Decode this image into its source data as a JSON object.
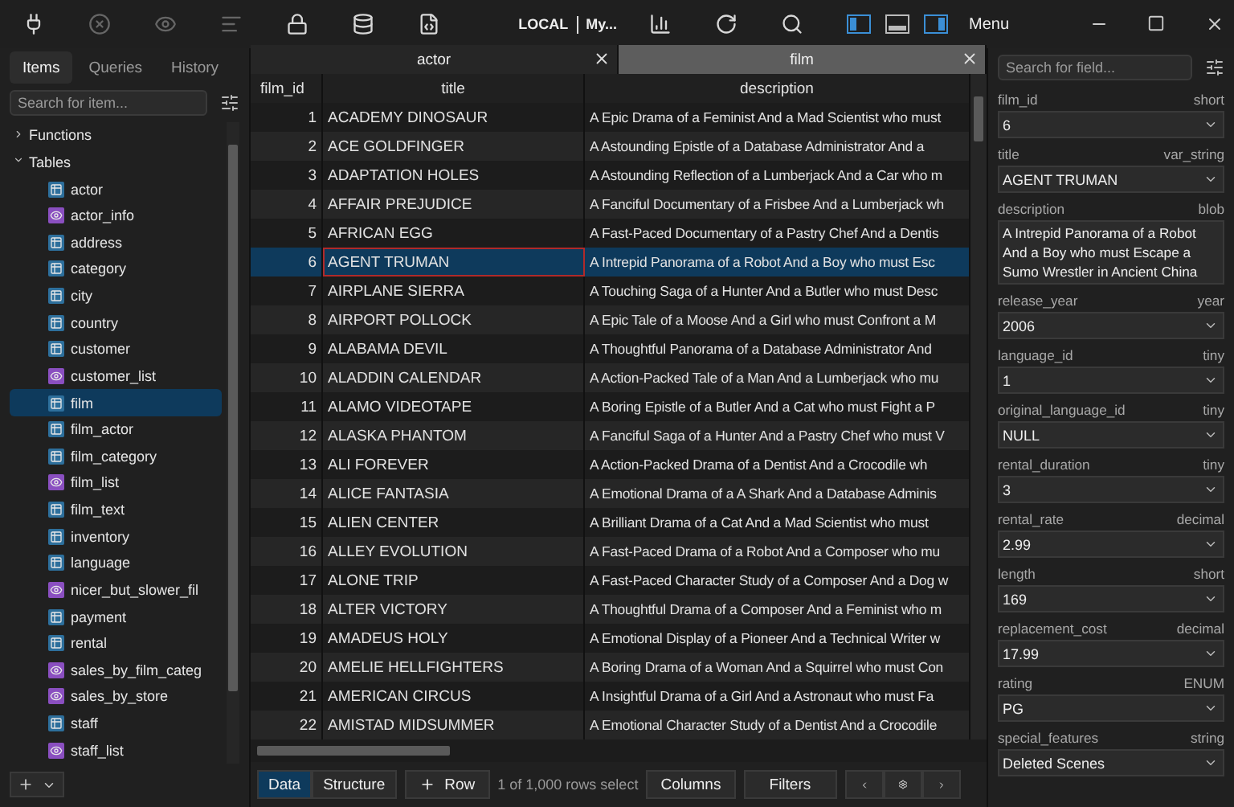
{
  "toolbar": {
    "connection": "LOCAL",
    "database": "My...",
    "panel_toggles": [
      {
        "kind": "left",
        "on": true
      },
      {
        "kind": "bottom",
        "on": false
      },
      {
        "kind": "right",
        "on": true
      }
    ],
    "menu": "Menu"
  },
  "sidebar": {
    "tabs": [
      {
        "label": "Items",
        "selected": true
      },
      {
        "label": "Queries",
        "selected": false
      },
      {
        "label": "History",
        "selected": false
      }
    ],
    "search": {
      "placeholder": "Search for item..."
    },
    "tree": [
      {
        "label": "Functions",
        "expanded": false
      },
      {
        "label": "Tables",
        "expanded": true,
        "children": [
          {
            "label": "actor",
            "kind": "table",
            "selected": false
          },
          {
            "label": "actor_info",
            "kind": "view",
            "selected": false
          },
          {
            "label": "address",
            "kind": "table",
            "selected": false
          },
          {
            "label": "category",
            "kind": "table",
            "selected": false
          },
          {
            "label": "city",
            "kind": "table",
            "selected": false
          },
          {
            "label": "country",
            "kind": "table",
            "selected": false
          },
          {
            "label": "customer",
            "kind": "table",
            "selected": false
          },
          {
            "label": "customer_list",
            "kind": "view",
            "selected": false
          },
          {
            "label": "film",
            "kind": "table",
            "selected": true
          },
          {
            "label": "film_actor",
            "kind": "table",
            "selected": false
          },
          {
            "label": "film_category",
            "kind": "table",
            "selected": false
          },
          {
            "label": "film_list",
            "kind": "view",
            "selected": false
          },
          {
            "label": "film_text",
            "kind": "table",
            "selected": false
          },
          {
            "label": "inventory",
            "kind": "table",
            "selected": false
          },
          {
            "label": "language",
            "kind": "table",
            "selected": false
          },
          {
            "label": "nicer_but_slower_fil",
            "kind": "view",
            "selected": false
          },
          {
            "label": "payment",
            "kind": "table",
            "selected": false
          },
          {
            "label": "rental",
            "kind": "table",
            "selected": false
          },
          {
            "label": "sales_by_film_categ",
            "kind": "view",
            "selected": false
          },
          {
            "label": "sales_by_store",
            "kind": "view",
            "selected": false
          },
          {
            "label": "staff",
            "kind": "table",
            "selected": false
          },
          {
            "label": "staff_list",
            "kind": "view",
            "selected": false
          }
        ]
      }
    ]
  },
  "tabs": [
    {
      "label": "actor",
      "selected": false
    },
    {
      "label": "film",
      "selected": true
    }
  ],
  "table": {
    "columns": [
      "film_id",
      "title",
      "description"
    ],
    "rows": [
      {
        "cells": [
          "1",
          "ACADEMY DINOSAUR",
          "A Epic Drama of a Feminist And a Mad Scientist who must"
        ],
        "selected": false
      },
      {
        "cells": [
          "2",
          "ACE GOLDFINGER",
          "A Astounding Epistle of a Database Administrator And a"
        ],
        "selected": false
      },
      {
        "cells": [
          "3",
          "ADAPTATION HOLES",
          "A Astounding Reflection of a Lumberjack And a Car who m"
        ],
        "selected": false
      },
      {
        "cells": [
          "4",
          "AFFAIR PREJUDICE",
          "A Fanciful Documentary of a Frisbee And a Lumberjack wh"
        ],
        "selected": false
      },
      {
        "cells": [
          "5",
          "AFRICAN EGG",
          "A Fast-Paced Documentary of a Pastry Chef And a Dentis"
        ],
        "selected": false
      },
      {
        "cells": [
          "6",
          "AGENT TRUMAN",
          "A Intrepid Panorama of a Robot And a Boy who must Esc"
        ],
        "selected": true
      },
      {
        "cells": [
          "7",
          "AIRPLANE SIERRA",
          "A Touching Saga of a Hunter And a Butler who must Desc"
        ],
        "selected": false
      },
      {
        "cells": [
          "8",
          "AIRPORT POLLOCK",
          "A Epic Tale of a Moose And a Girl who must Confront a M"
        ],
        "selected": false
      },
      {
        "cells": [
          "9",
          "ALABAMA DEVIL",
          "A Thoughtful Panorama of a Database Administrator And"
        ],
        "selected": false
      },
      {
        "cells": [
          "10",
          "ALADDIN CALENDAR",
          "A Action-Packed Tale of a Man And a Lumberjack who mu"
        ],
        "selected": false
      },
      {
        "cells": [
          "11",
          "ALAMO VIDEOTAPE",
          "A Boring Epistle of a Butler And a Cat who must Fight a P"
        ],
        "selected": false
      },
      {
        "cells": [
          "12",
          "ALASKA PHANTOM",
          "A Fanciful Saga of a Hunter And a Pastry Chef who must V"
        ],
        "selected": false
      },
      {
        "cells": [
          "13",
          "ALI FOREVER",
          "A Action-Packed Drama of a Dentist And a Crocodile wh"
        ],
        "selected": false
      },
      {
        "cells": [
          "14",
          "ALICE FANTASIA",
          "A Emotional Drama of a A Shark And a Database Adminis"
        ],
        "selected": false
      },
      {
        "cells": [
          "15",
          "ALIEN CENTER",
          "A Brilliant Drama of a Cat And a Mad Scientist who must"
        ],
        "selected": false
      },
      {
        "cells": [
          "16",
          "ALLEY EVOLUTION",
          "A Fast-Paced Drama of a Robot And a Composer who mu"
        ],
        "selected": false
      },
      {
        "cells": [
          "17",
          "ALONE TRIP",
          "A Fast-Paced Character Study of a Composer And a Dog w"
        ],
        "selected": false
      },
      {
        "cells": [
          "18",
          "ALTER VICTORY",
          "A Thoughtful Drama of a Composer And a Feminist who m"
        ],
        "selected": false
      },
      {
        "cells": [
          "19",
          "AMADEUS HOLY",
          "A Emotional Display of a Pioneer And a Technical Writer w"
        ],
        "selected": false
      },
      {
        "cells": [
          "20",
          "AMELIE HELLFIGHTERS",
          "A Boring Drama of a Woman And a Squirrel who must Con"
        ],
        "selected": false
      },
      {
        "cells": [
          "21",
          "AMERICAN CIRCUS",
          "A Insightful Drama of a Girl And a Astronaut who must Fa"
        ],
        "selected": false
      },
      {
        "cells": [
          "22",
          "AMISTAD MIDSUMMER",
          "A Emotional Character Study of a Dentist And a Crocodile"
        ],
        "selected": false
      }
    ]
  },
  "bottom_bar": {
    "views": [
      {
        "label": "Data",
        "selected": true
      },
      {
        "label": "Structure",
        "selected": false
      }
    ],
    "add_row": "Row",
    "status": "1 of 1,000 rows select",
    "columns": "Columns",
    "filters": "Filters"
  },
  "record_panel": {
    "search": {
      "placeholder": "Search for field..."
    },
    "fields": [
      {
        "name": "film_id",
        "type": "short",
        "value": "6",
        "kind": "select"
      },
      {
        "name": "title",
        "type": "var_string",
        "value": "AGENT TRUMAN",
        "kind": "select"
      },
      {
        "name": "description",
        "type": "blob",
        "value": "A Intrepid Panorama of a Robot And a Boy who must Escape a Sumo Wrestler in Ancient China",
        "kind": "text"
      },
      {
        "name": "release_year",
        "type": "year",
        "value": "2006",
        "kind": "select"
      },
      {
        "name": "language_id",
        "type": "tiny",
        "value": "1",
        "kind": "select"
      },
      {
        "name": "original_language_id",
        "type": "tiny",
        "value": "NULL",
        "kind": "select"
      },
      {
        "name": "rental_duration",
        "type": "tiny",
        "value": "3",
        "kind": "select"
      },
      {
        "name": "rental_rate",
        "type": "decimal",
        "value": "2.99",
        "kind": "select"
      },
      {
        "name": "length",
        "type": "short",
        "value": "169",
        "kind": "select"
      },
      {
        "name": "replacement_cost",
        "type": "decimal",
        "value": "17.99",
        "kind": "select"
      },
      {
        "name": "rating",
        "type": "ENUM",
        "value": "PG",
        "kind": "select"
      },
      {
        "name": "special_features",
        "type": "string",
        "value": "Deleted Scenes",
        "kind": "select"
      }
    ]
  }
}
